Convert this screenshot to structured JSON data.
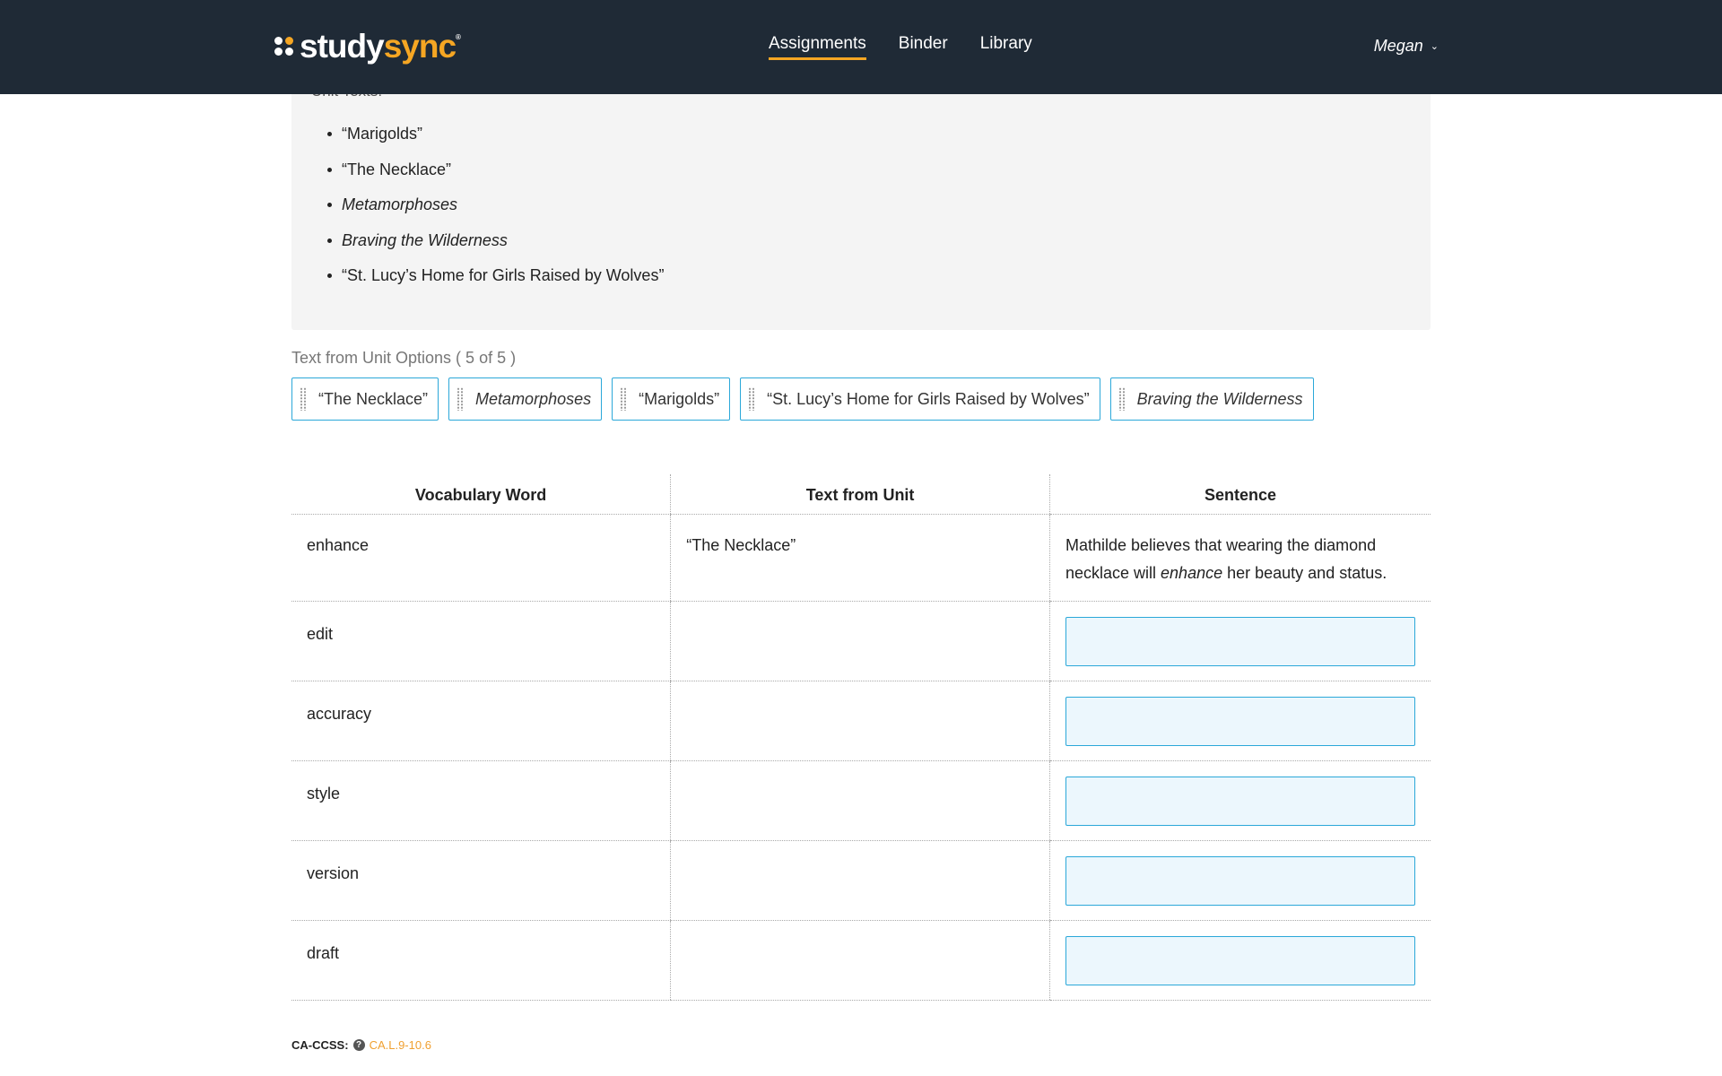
{
  "header": {
    "logo_study": "study",
    "logo_sync": "sync",
    "logo_mark": "®",
    "nav": [
      {
        "label": "Assignments",
        "active": true
      },
      {
        "label": "Binder",
        "active": false
      },
      {
        "label": "Library",
        "active": false
      }
    ],
    "user_name": "Megan",
    "user_menu_icon": "chevron-down-icon"
  },
  "unit_texts": {
    "cut_label": "Unit Texts:",
    "items": [
      "“Marigolds”",
      "“The Necklace”",
      "Metamorphoses",
      "Braving the Wilderness",
      "“St. Lucy’s Home for Girls Raised by Wolves”"
    ]
  },
  "options": {
    "label": "Text from Unit Options ( 5 of 5 )",
    "chips": [
      "“The Necklace”",
      "Metamorphoses",
      "“Marigolds”",
      "“St. Lucy’s Home for Girls Raised by Wolves”",
      "Braving the Wilderness"
    ]
  },
  "table": {
    "headers": [
      "Vocabulary Word",
      "Text from Unit",
      "Sentence"
    ],
    "rows": [
      {
        "word": "enhance",
        "text": "“The Necklace”",
        "sentence_before": "Mathilde believes that wearing the diamond necklace will ",
        "sentence_em": "enhance",
        "sentence_after": " her beauty and status."
      },
      {
        "word": "edit",
        "text": "",
        "sentence": ""
      },
      {
        "word": "accuracy",
        "text": "",
        "sentence": ""
      },
      {
        "word": "style",
        "text": "",
        "sentence": ""
      },
      {
        "word": "version",
        "text": "",
        "sentence": ""
      },
      {
        "word": "draft",
        "text": "",
        "sentence": ""
      }
    ]
  },
  "standards": {
    "label": "CA-CCSS:",
    "help_icon": "question-circle-icon",
    "help_glyph": "?",
    "code": "CA.L.9-10.6"
  },
  "colors": {
    "header_bg": "#1f2a36",
    "accent": "#f5a623",
    "input_border": "#2ba8d9",
    "input_bg": "#ecf7fd"
  }
}
